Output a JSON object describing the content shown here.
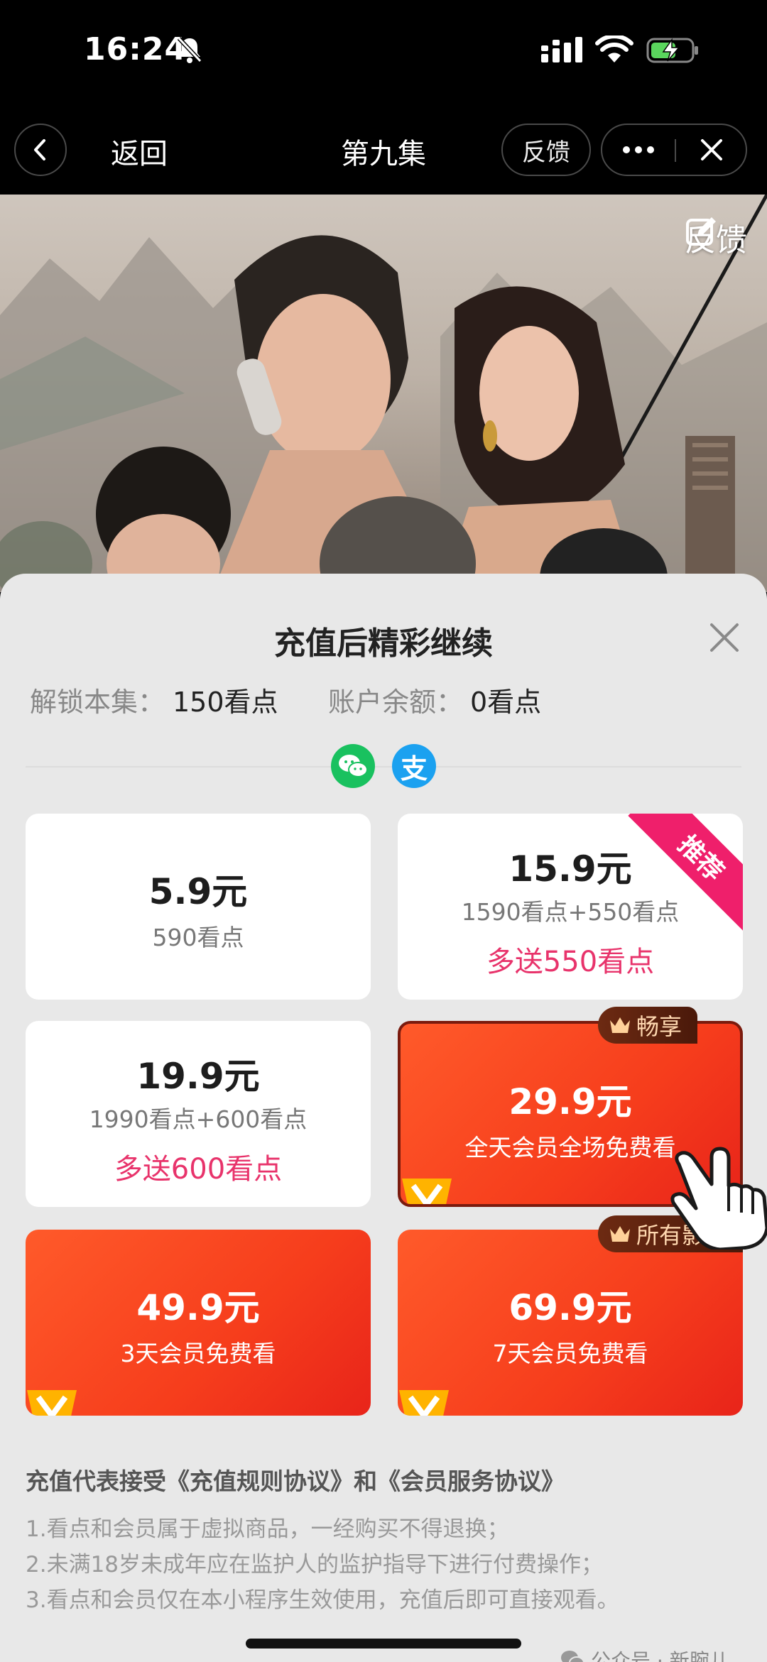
{
  "status_bar": {
    "time": "16:24",
    "icons": [
      "bell-off-icon",
      "signal-icon",
      "wifi-icon",
      "battery-charging-icon"
    ]
  },
  "nav": {
    "back_label": "返回",
    "title": "第九集",
    "feedback_label": "反馈",
    "icons": [
      "back-chevron-icon",
      "more-icon",
      "close-icon"
    ]
  },
  "poster": {
    "feedback_label": "反馈",
    "icon": "edit-icon"
  },
  "sheet": {
    "title": "充值后精彩继续",
    "unlock_label": "解锁本集：",
    "unlock_value": "150看点",
    "balance_label": "账户余额：",
    "balance_value": "0看点",
    "pay_methods": [
      "wechat-pay-icon",
      "alipay-icon"
    ],
    "alipay_glyph": "支",
    "plans": [
      {
        "price": "5.9元",
        "desc": "590看点",
        "bonus": ""
      },
      {
        "price": "15.9元",
        "desc": "1590看点+550看点",
        "bonus": "多送550看点",
        "ribbon": "推荐"
      },
      {
        "price": "19.9元",
        "desc": "1990看点+600看点",
        "bonus": "多送600看点"
      },
      {
        "price": "29.9元",
        "desc": "全天会员全场免费看",
        "tag": "畅享",
        "selected": true
      },
      {
        "price": "49.9元",
        "desc": "3天会员免费看"
      },
      {
        "price": "69.9元",
        "desc": "7天会员免费看",
        "tag": "所有影片"
      }
    ],
    "agreement": "充值代表接受《充值规则协议》和《会员服务协议》",
    "rules": [
      "1.看点和会员属于虚拟商品，一经购买不得退换；",
      "2.未满18岁未成年应在监护人的监护指导下进行付费操作；",
      "3.看点和会员仅在本小程序生效使用，充值后即可直接观看。"
    ],
    "watermark": "公众号 · 新腕儿"
  },
  "colors": {
    "accent_pink": "#e8336b",
    "vip_red": "#f63d1c",
    "ribbon": "#ef1f6b",
    "wechat": "#19c15f",
    "alipay": "#1ba1f0"
  }
}
